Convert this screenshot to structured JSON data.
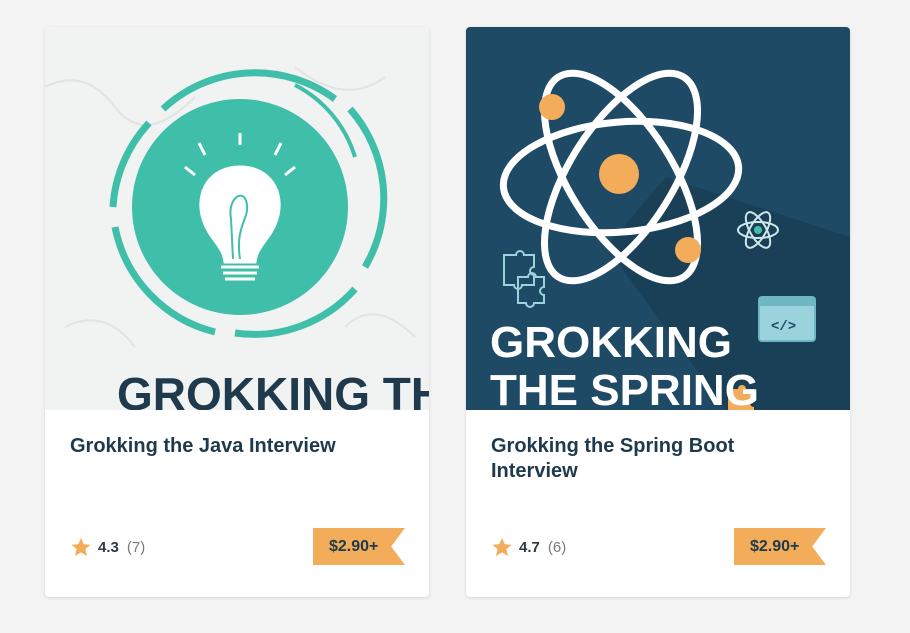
{
  "courses": [
    {
      "title": "Grokking the Java Interview",
      "cover_text_line1": "GROKKING THE",
      "rating": "4.3",
      "reviews": "(7)",
      "price": "$2.90+"
    },
    {
      "title": "Grokking the Spring Boot Interview",
      "cover_text_line1": "GROKKING",
      "cover_text_line2": "THE SPRING",
      "rating": "4.7",
      "reviews": "(6)",
      "price": "$2.90+"
    }
  ],
  "colors": {
    "teal": "#3fbfa9",
    "navy": "#1e4a66",
    "orange": "#f3ad5a",
    "title": "#1e3a4c"
  },
  "icons": [
    "star-icon",
    "lightbulb-icon",
    "atom-icon",
    "puzzle-icon",
    "code-window-icon"
  ]
}
